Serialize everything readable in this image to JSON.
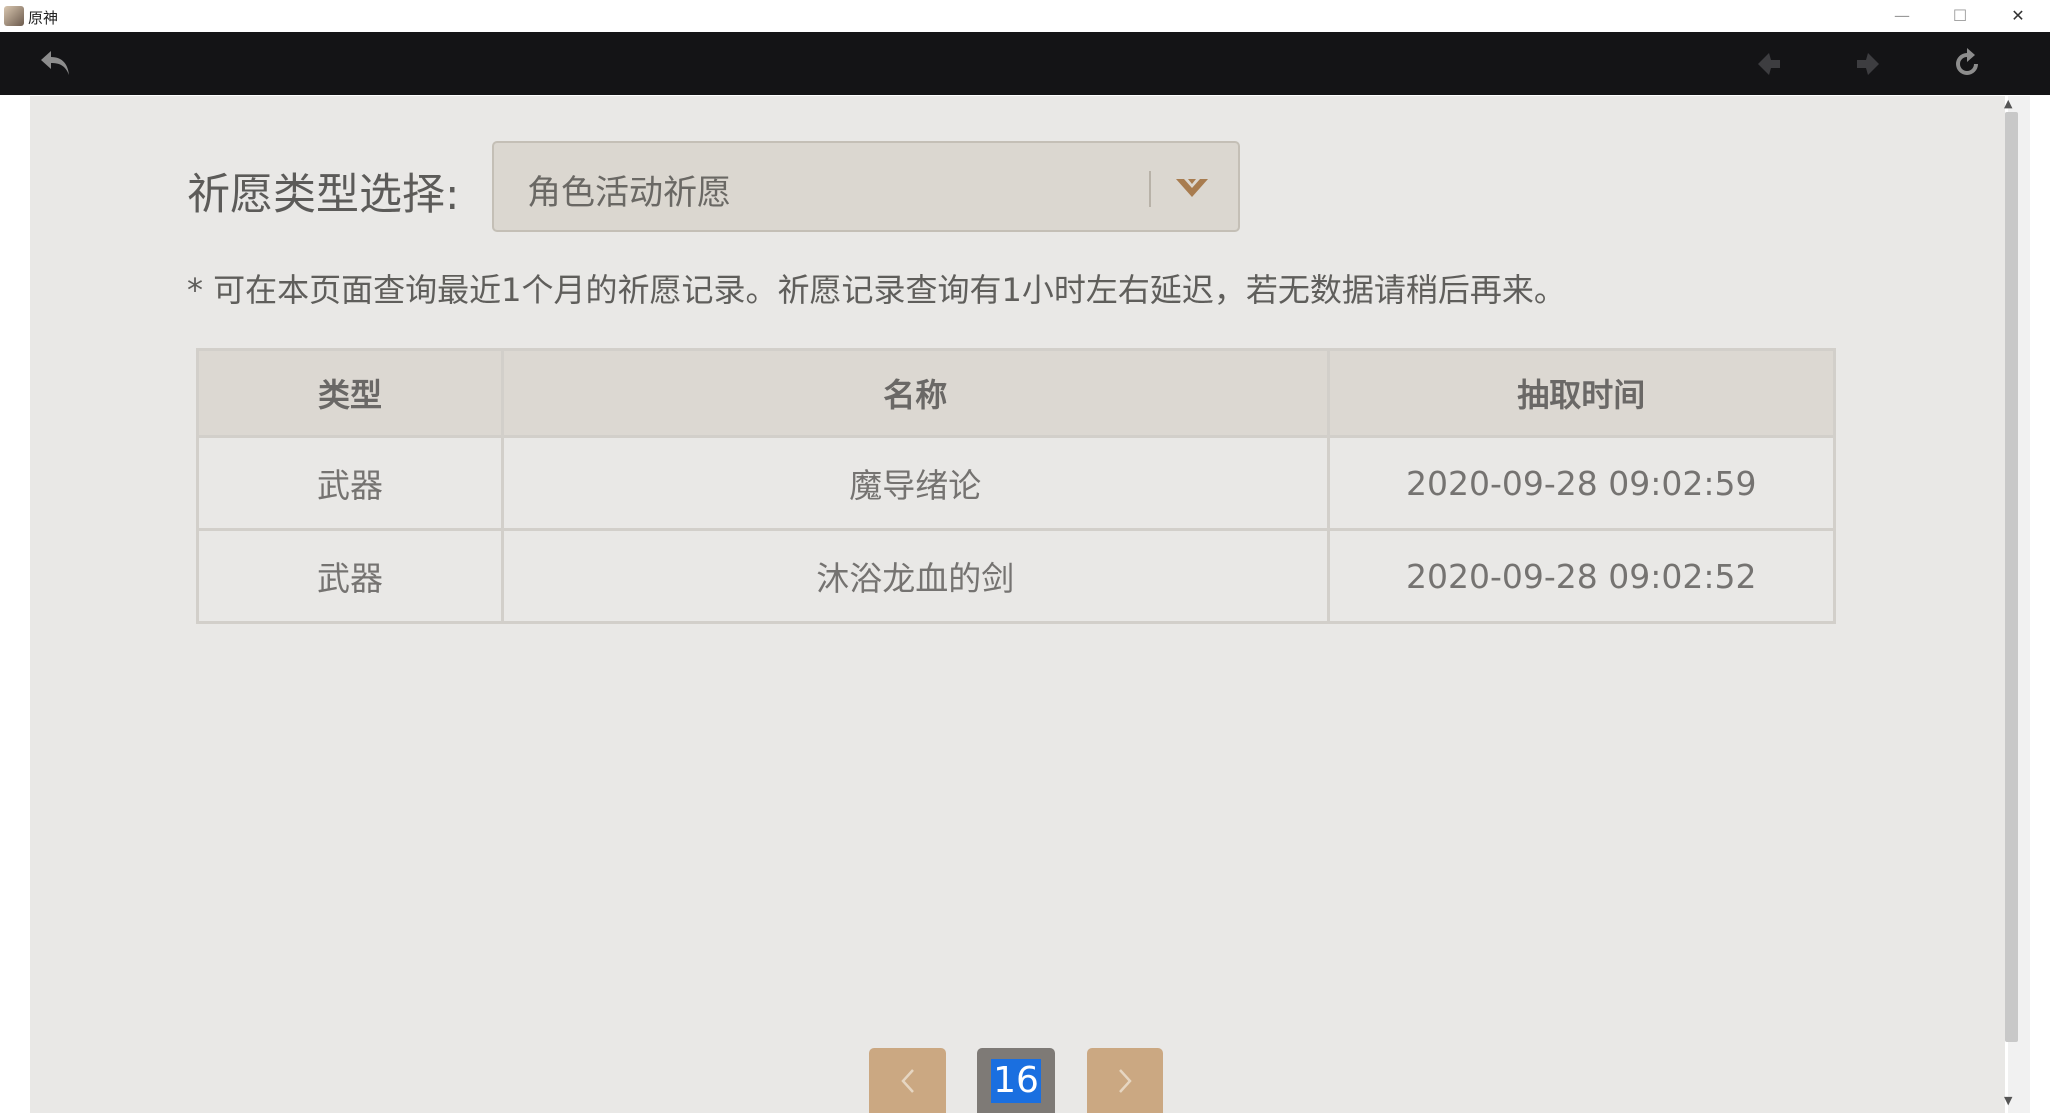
{
  "window": {
    "title": "原神",
    "min": "—",
    "max": "☐",
    "close": "✕"
  },
  "toolbar": {
    "back_icon": "back-arrow-icon",
    "forward_icon": "forward-arrow-icon",
    "refresh_icon": "refresh-icon"
  },
  "filter": {
    "label": "祈愿类型选择:",
    "selected": "角色活动祈愿"
  },
  "note": "* 可在本页面查询最近1个月的祈愿记录。祈愿记录查询有1小时左右延迟，若无数据请稍后再来。",
  "table": {
    "headers": [
      "类型",
      "名称",
      "抽取时间"
    ],
    "rows": [
      [
        "武器",
        "魔导绪论",
        "2020-09-28 09:02:59"
      ],
      [
        "武器",
        "沐浴龙血的剑",
        "2020-09-28 09:02:52"
      ]
    ]
  },
  "pagination": {
    "current": "16"
  },
  "colors": {
    "accent": "#cba882",
    "current_page_bg": "#7e7a76",
    "selection": "#1a6fe0"
  }
}
